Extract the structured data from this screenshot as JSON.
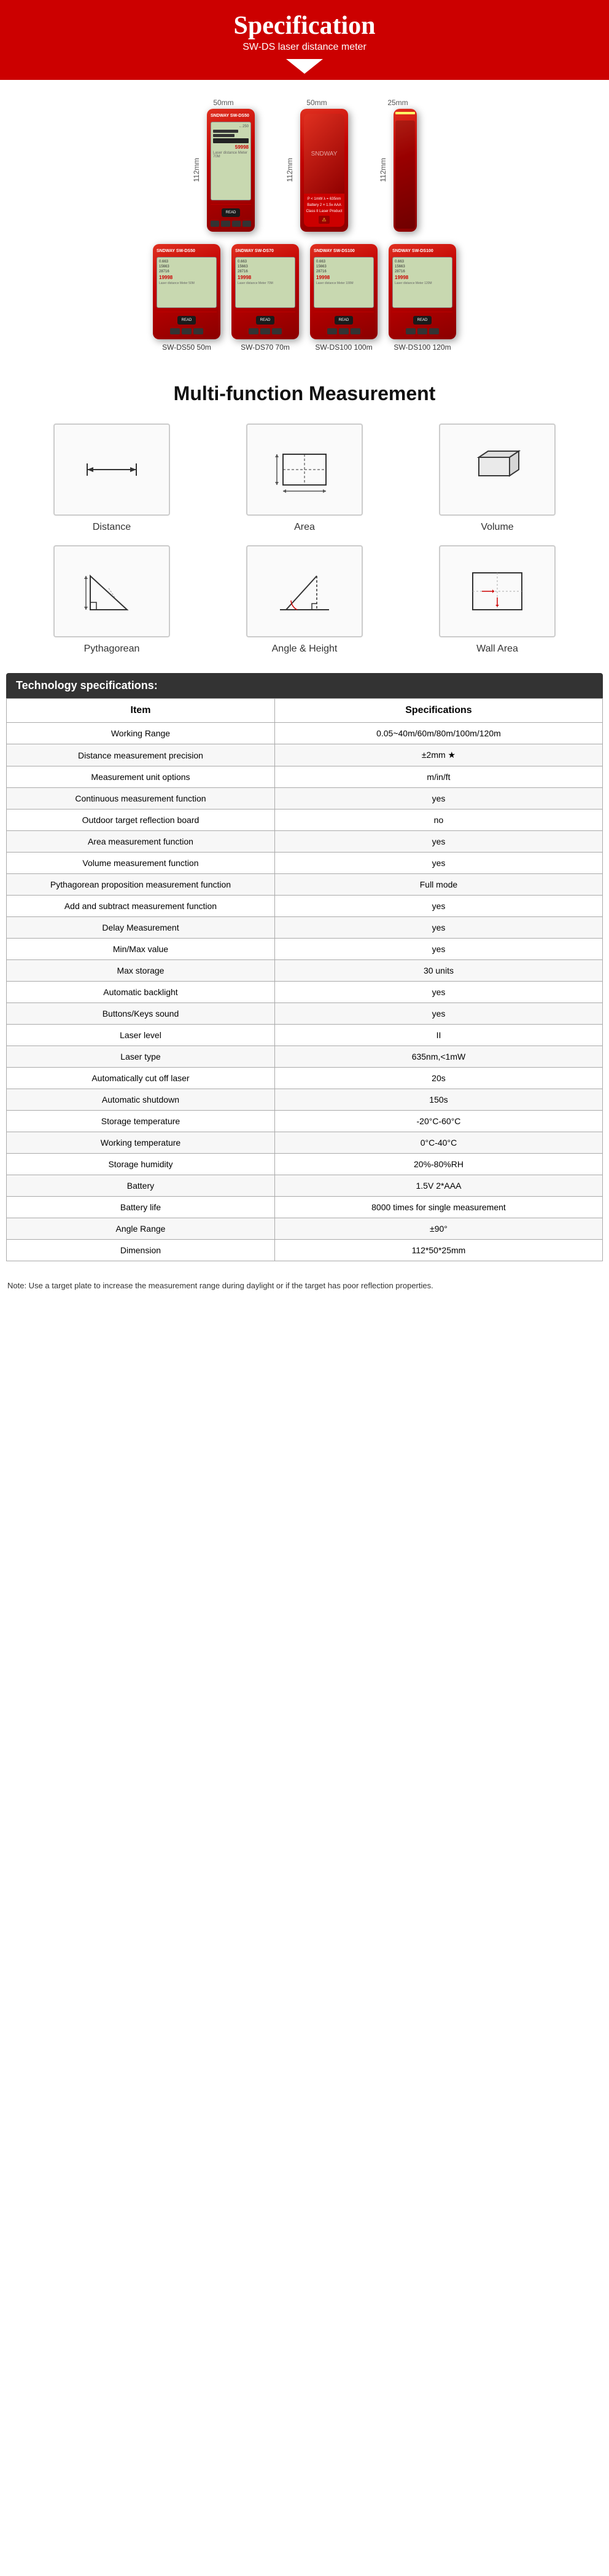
{
  "header": {
    "title": "Specification",
    "subtitle": "SW-DS laser distance meter"
  },
  "products_top": [
    {
      "width": "50mm",
      "height": "112mm",
      "depth": null
    },
    {
      "width": "50mm",
      "height": "112mm",
      "depth": null
    },
    {
      "width": "25mm",
      "height": "112mm",
      "depth": null
    }
  ],
  "products_bottom": [
    {
      "label": "SW-DS50 50m"
    },
    {
      "label": "SW-DS70 70m"
    },
    {
      "label": "SW-DS100 100m"
    },
    {
      "label": "SW-DS100 120m"
    }
  ],
  "multifunction": {
    "title": "Multi-function Measurement",
    "items": [
      {
        "label": "Distance"
      },
      {
        "label": "Area"
      },
      {
        "label": "Volume"
      },
      {
        "label": "Pythagorean"
      },
      {
        "label": "Angle & Height"
      },
      {
        "label": "Wall Area"
      }
    ]
  },
  "specs": {
    "header": "Technology specifications:",
    "col_item": "Item",
    "col_spec": "Specifications",
    "rows": [
      {
        "item": "Working Range",
        "spec": "0.05~40m/60m/80m/100m/120m"
      },
      {
        "item": "Distance measurement precision",
        "spec": "±2mm ★"
      },
      {
        "item": "Measurement unit options",
        "spec": "m/in/ft"
      },
      {
        "item": "Continuous measurement function",
        "spec": "yes"
      },
      {
        "item": "Outdoor target reflection board",
        "spec": "no"
      },
      {
        "item": "Area measurement function",
        "spec": "yes"
      },
      {
        "item": "Volume measurement function",
        "spec": "yes"
      },
      {
        "item": "Pythagorean proposition measurement function",
        "spec": "Full mode"
      },
      {
        "item": "Add and subtract measurement function",
        "spec": "yes"
      },
      {
        "item": "Delay Measurement",
        "spec": "yes"
      },
      {
        "item": "Min/Max value",
        "spec": "yes"
      },
      {
        "item": "Max storage",
        "spec": "30 units"
      },
      {
        "item": "Automatic backlight",
        "spec": "yes"
      },
      {
        "item": "Buttons/Keys sound",
        "spec": "yes"
      },
      {
        "item": "Laser level",
        "spec": "II"
      },
      {
        "item": "Laser type",
        "spec": "635nm,<1mW"
      },
      {
        "item": "Automatically cut off laser",
        "spec": "20s"
      },
      {
        "item": "Automatic shutdown",
        "spec": "150s"
      },
      {
        "item": "Storage temperature",
        "spec": "-20°C-60°C"
      },
      {
        "item": "Working temperature",
        "spec": "0°C-40°C"
      },
      {
        "item": "Storage humidity",
        "spec": "20%-80%RH"
      },
      {
        "item": "Battery",
        "spec": "1.5V 2*AAA"
      },
      {
        "item": "Battery life",
        "spec": "8000 times for single measurement"
      },
      {
        "item": "Angle Range",
        "spec": "±90°"
      },
      {
        "item": "Dimension",
        "spec": "112*50*25mm"
      }
    ]
  },
  "note": "Note: Use a target plate to increase the measurement range during daylight or if the target has poor reflection properties."
}
